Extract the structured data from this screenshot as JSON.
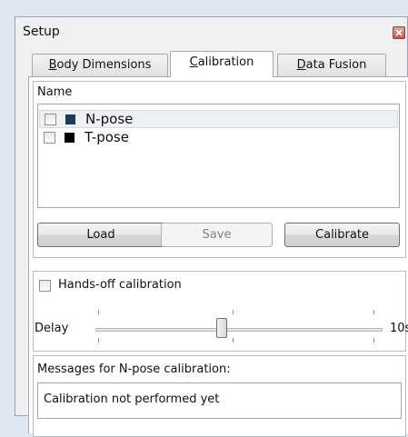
{
  "window": {
    "title": "Setup"
  },
  "tabs": [
    {
      "label": "Body Dimensions",
      "underline_char": "B",
      "rest": "ody Dimensions",
      "active": false
    },
    {
      "label": "Calibration",
      "underline_char": "C",
      "rest": "alibration",
      "active": true
    },
    {
      "label": "Data Fusion",
      "underline_char": "D",
      "rest": "ata Fusion",
      "active": false
    }
  ],
  "calibration": {
    "name_label": "Name",
    "items": [
      {
        "label": "N-pose",
        "color": "#1f3b5c",
        "checked": false,
        "selected": true
      },
      {
        "label": "T-pose",
        "color": "#000000",
        "checked": false,
        "selected": false
      }
    ],
    "buttons": {
      "load": "Load",
      "save": "Save",
      "calibrate": "Calibrate"
    }
  },
  "handsoff": {
    "checkbox_label": "Hands-off calibration",
    "checked": false,
    "delay_label": "Delay",
    "delay_value": "10s",
    "slider_fraction": 0.5
  },
  "messages": {
    "label": "Messages for N-pose calibration:",
    "text": "Calibration not performed yet"
  },
  "icons": {
    "close": "close-icon",
    "checkbox": "checkbox-icon"
  }
}
